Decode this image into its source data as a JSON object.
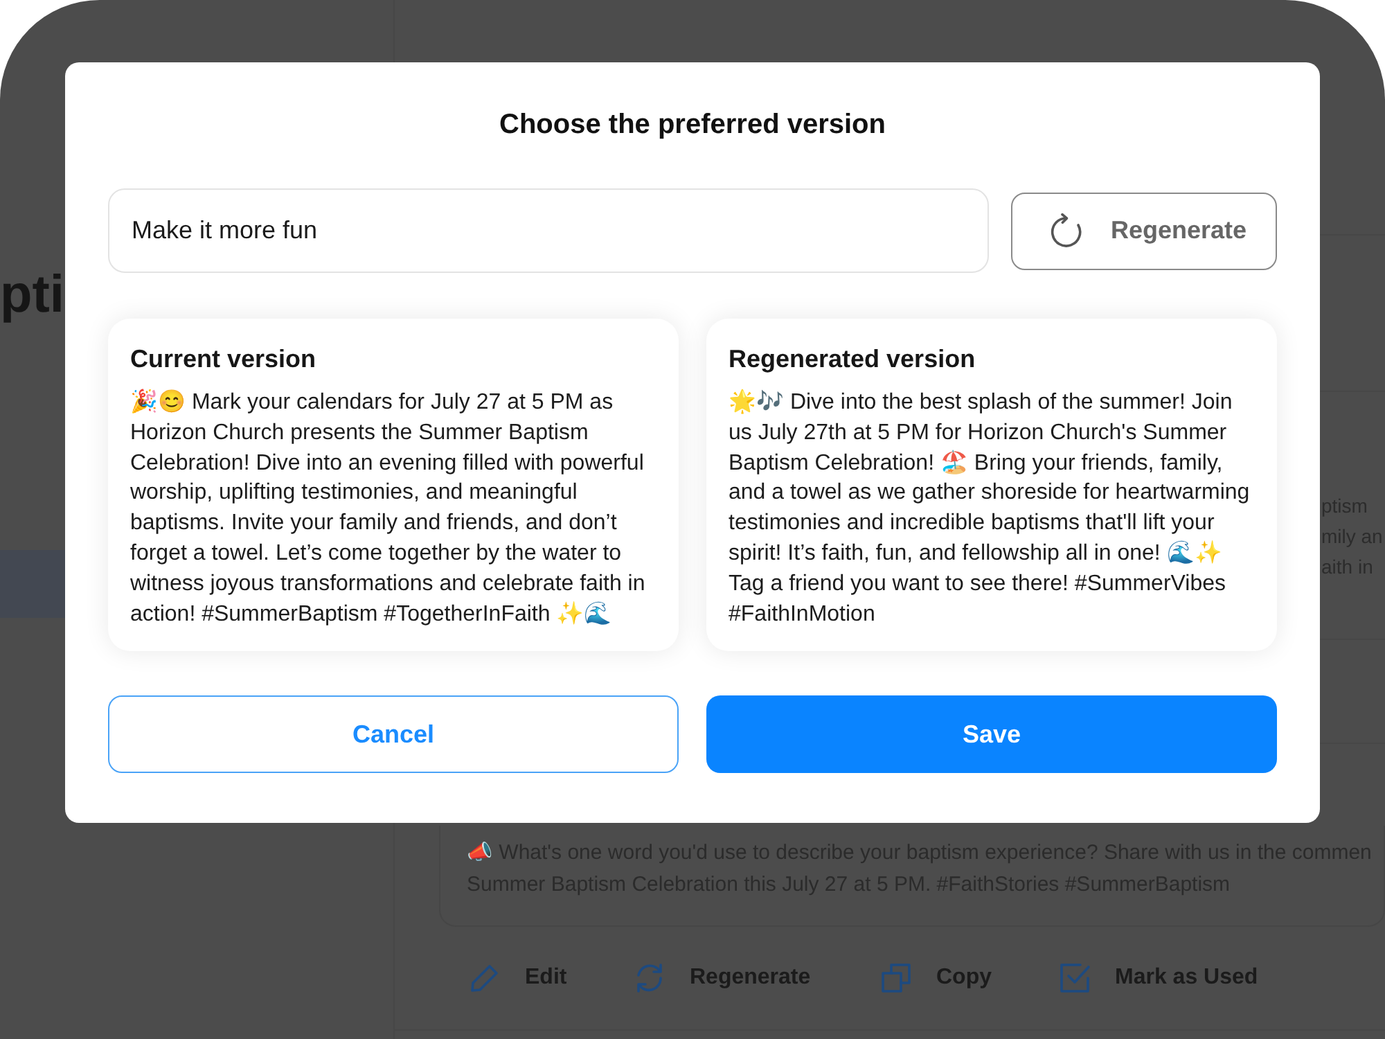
{
  "background": {
    "heading": "pti",
    "side_snippet_lines": [
      "ptism",
      "mily an",
      "aith in"
    ],
    "post": {
      "lines": [
        "📣 What's one word you'd use to describe your baptism experience? Share with us in the commen",
        "Summer Baptism Celebration this July 27 at 5 PM. #FaithStories #SummerBaptism"
      ],
      "actions": [
        {
          "kind": "edit",
          "label": "Edit"
        },
        {
          "kind": "regenerate",
          "label": "Regenerate"
        },
        {
          "kind": "copy",
          "label": "Copy"
        },
        {
          "kind": "mark_used",
          "label": "Mark as Used"
        }
      ]
    }
  },
  "dialog": {
    "title": "Choose the preferred version",
    "prompt": {
      "value": "Make it more fun"
    },
    "regenerate_button": "Regenerate",
    "versions": [
      {
        "title": "Current version",
        "text": "🎉😊 Mark your calendars for July 27 at 5 PM as Horizon Church presents the Summer Baptism Celebration! Dive into an evening filled with powerful worship, uplifting testimonies, and meaningful baptisms. Invite your family and friends, and don’t forget a towel. Let’s come together by the water to witness joyous transformations and celebrate faith in action! #SummerBaptism #TogetherInFaith ✨🌊"
      },
      {
        "title": "Regenerated version",
        "text": "🌟🎶 Dive into the best splash of the summer! Join us July 27th at 5 PM for Horizon Church's Summer Baptism Celebration! 🏖️ Bring your friends, family, and a towel as we gather shoreside for heartwarming testimonies and incredible baptisms that'll lift your spirit! It’s faith, fun, and fellowship all in one! 🌊✨ Tag a friend you want to see there! #SummerVibes #FaithInMotion"
      }
    ],
    "buttons": [
      {
        "kind": "secondary",
        "label": "Cancel"
      },
      {
        "kind": "primary",
        "label": "Save"
      }
    ]
  }
}
